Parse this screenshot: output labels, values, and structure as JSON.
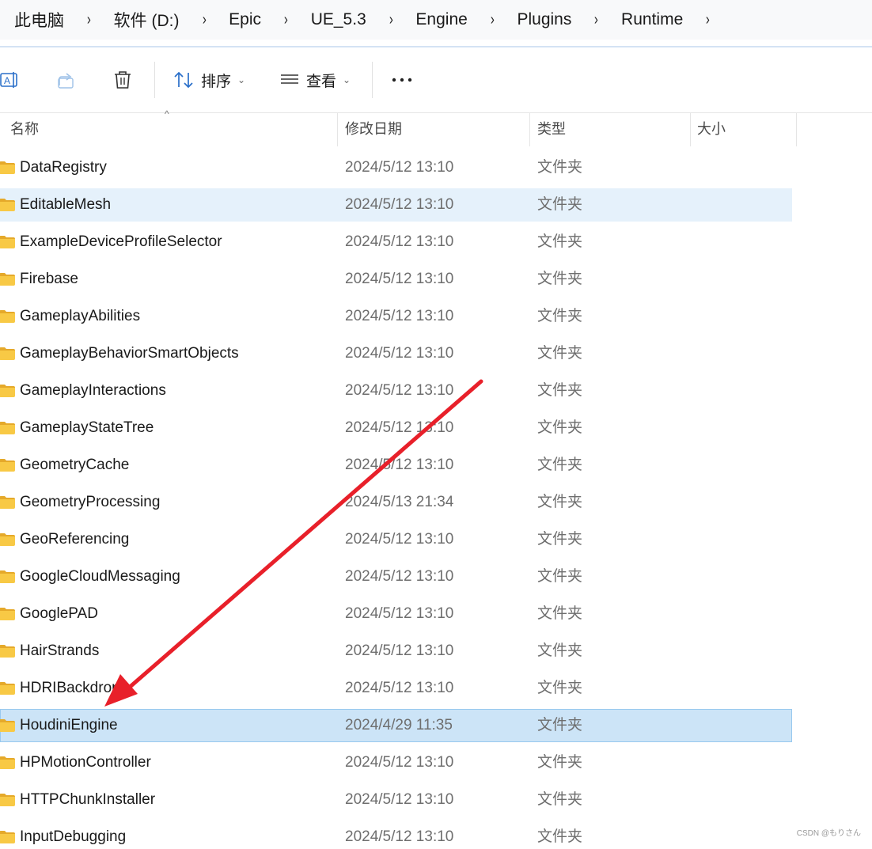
{
  "breadcrumb": {
    "items": [
      {
        "label": "此电脑"
      },
      {
        "label": "软件 (D:)"
      },
      {
        "label": "Epic"
      },
      {
        "label": "UE_5.3"
      },
      {
        "label": "Engine"
      },
      {
        "label": "Plugins"
      },
      {
        "label": "Runtime"
      }
    ],
    "separator": "›"
  },
  "toolbar": {
    "rename_icon": "rename-icon",
    "share_icon": "share-icon",
    "delete_icon": "trash-icon",
    "sort_label": "排序",
    "view_label": "查看",
    "more_label": "···",
    "caret": "⌄"
  },
  "columns": {
    "name": "名称",
    "modified": "修改日期",
    "type": "类型",
    "size": "大小",
    "sort_indicator": "^"
  },
  "files": [
    {
      "name": "DataRegistry",
      "date": "2024/5/12 13:10",
      "type": "文件夹",
      "state": "normal"
    },
    {
      "name": "EditableMesh",
      "date": "2024/5/12 13:10",
      "type": "文件夹",
      "state": "hover"
    },
    {
      "name": "ExampleDeviceProfileSelector",
      "date": "2024/5/12 13:10",
      "type": "文件夹",
      "state": "normal"
    },
    {
      "name": "Firebase",
      "date": "2024/5/12 13:10",
      "type": "文件夹",
      "state": "normal"
    },
    {
      "name": "GameplayAbilities",
      "date": "2024/5/12 13:10",
      "type": "文件夹",
      "state": "normal"
    },
    {
      "name": "GameplayBehaviorSmartObjects",
      "date": "2024/5/12 13:10",
      "type": "文件夹",
      "state": "normal"
    },
    {
      "name": "GameplayInteractions",
      "date": "2024/5/12 13:10",
      "type": "文件夹",
      "state": "normal"
    },
    {
      "name": "GameplayStateTree",
      "date": "2024/5/12 13:10",
      "type": "文件夹",
      "state": "normal"
    },
    {
      "name": "GeometryCache",
      "date": "2024/5/12 13:10",
      "type": "文件夹",
      "state": "normal"
    },
    {
      "name": "GeometryProcessing",
      "date": "2024/5/13 21:34",
      "type": "文件夹",
      "state": "normal"
    },
    {
      "name": "GeoReferencing",
      "date": "2024/5/12 13:10",
      "type": "文件夹",
      "state": "normal"
    },
    {
      "name": "GoogleCloudMessaging",
      "date": "2024/5/12 13:10",
      "type": "文件夹",
      "state": "normal"
    },
    {
      "name": "GooglePAD",
      "date": "2024/5/12 13:10",
      "type": "文件夹",
      "state": "normal"
    },
    {
      "name": "HairStrands",
      "date": "2024/5/12 13:10",
      "type": "文件夹",
      "state": "normal"
    },
    {
      "name": "HDRIBackdrop",
      "date": "2024/5/12 13:10",
      "type": "文件夹",
      "state": "normal"
    },
    {
      "name": "HoudiniEngine",
      "date": "2024/4/29 11:35",
      "type": "文件夹",
      "state": "selected"
    },
    {
      "name": "HPMotionController",
      "date": "2024/5/12 13:10",
      "type": "文件夹",
      "state": "normal"
    },
    {
      "name": "HTTPChunkInstaller",
      "date": "2024/5/12 13:10",
      "type": "文件夹",
      "state": "normal"
    },
    {
      "name": "InputDebugging",
      "date": "2024/5/12 13:10",
      "type": "文件夹",
      "state": "normal"
    }
  ],
  "annotation": {
    "arrow_color": "#e8202a",
    "points_to": "HoudiniEngine"
  },
  "watermark": "CSDN @もりさん",
  "colors": {
    "hover_row": "#e5f1fb",
    "selected_row": "#cce4f7",
    "selected_border": "#99c9ef",
    "folder_body": "#f8c945",
    "folder_tab": "#e5a92a"
  }
}
